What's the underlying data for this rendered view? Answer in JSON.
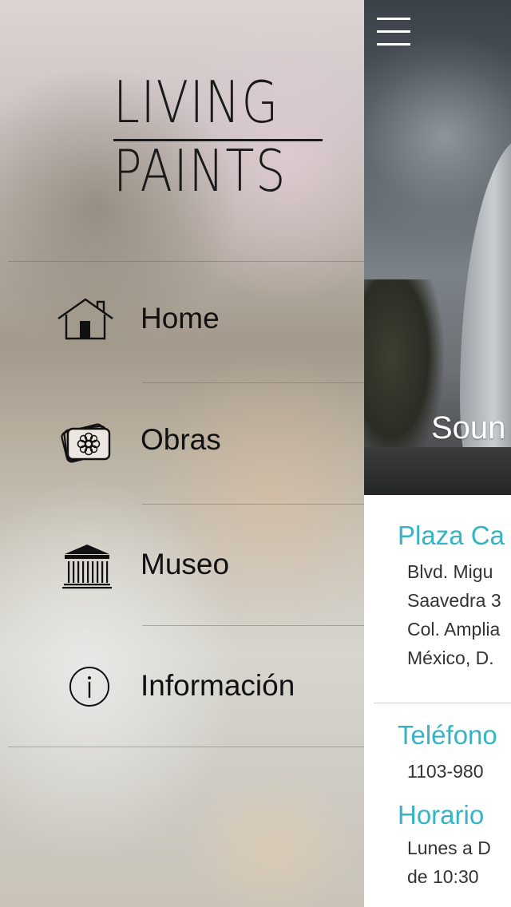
{
  "menu": {
    "logo": {
      "line1": "LIVING",
      "line2": "PAINTS"
    },
    "items": [
      {
        "label": "Home",
        "icon": "home-icon"
      },
      {
        "label": "Obras",
        "icon": "artworks-icon"
      },
      {
        "label": "Museo",
        "icon": "museum-icon"
      },
      {
        "label": "Información",
        "icon": "info-icon"
      }
    ]
  },
  "content": {
    "hero_title": "Soun",
    "address": {
      "heading": "Plaza Ca",
      "lines": [
        "Blvd. Migu",
        "Saavedra 3",
        "Col. Amplia",
        "México, D."
      ]
    },
    "phone": {
      "heading": "Teléfono",
      "value": "1103-980"
    },
    "hours": {
      "heading": "Horario",
      "lines": [
        "Lunes a D",
        "de 10:30"
      ]
    }
  },
  "colors": {
    "accent": "#36b4c6",
    "text": "#111111"
  }
}
